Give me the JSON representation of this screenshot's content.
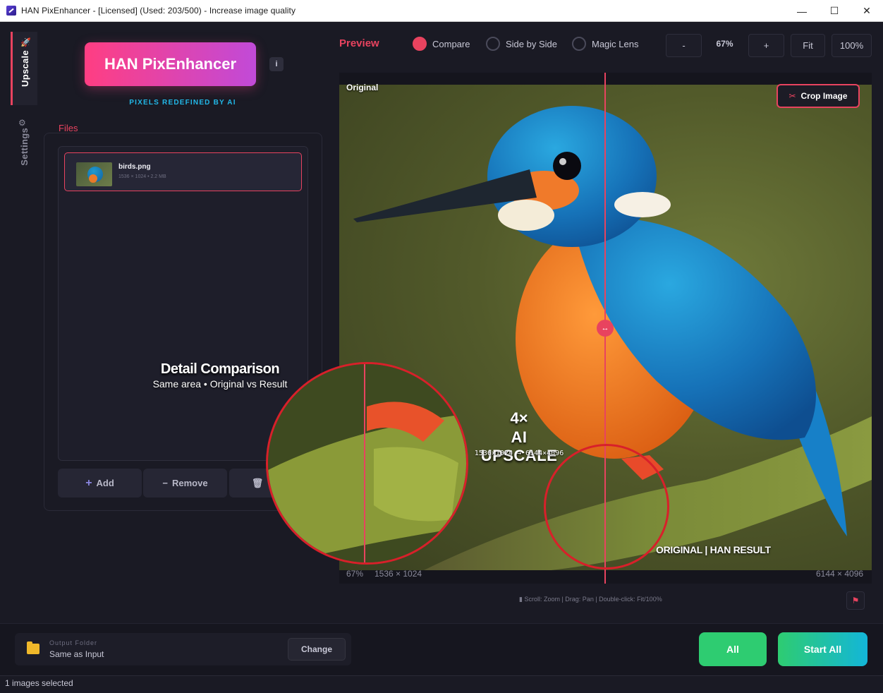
{
  "window": {
    "title": "HAN PixEnhancer - [Licensed] (Used: 203/500) - Increase image quality",
    "controls": {
      "minimize": "—",
      "maximize": "☐",
      "close": "✕"
    }
  },
  "sidebar": {
    "tabs": [
      {
        "label": "Upscale",
        "icon": "rocket-icon",
        "active": true
      },
      {
        "label": "Settings",
        "icon": "gear-icon",
        "active": false
      }
    ]
  },
  "brand": {
    "name": "HAN PixEnhancer",
    "tagline": "PIXELS REDEFINED BY AI",
    "info_icon": "i"
  },
  "files": {
    "label": "Files",
    "items": [
      {
        "name": "birds.png",
        "meta": "1536 × 1024  •  2.2 MB"
      }
    ],
    "buttons": {
      "add": "Add",
      "remove": "Remove"
    }
  },
  "preview": {
    "title": "Preview",
    "modes": [
      {
        "label": "Compare",
        "selected": true
      },
      {
        "label": "Side by Side",
        "selected": false
      },
      {
        "label": "Magic Lens",
        "selected": false
      }
    ],
    "zoom": {
      "minus": "-",
      "level": "67%",
      "plus": "+",
      "fit": "Fit",
      "full": "100%"
    },
    "original_label": "Original",
    "crop_label": "Crop Image",
    "footer": {
      "zoom": "67%",
      "original_size": "1536 × 1024",
      "result_size": "6144 × 4096"
    },
    "hint": "Scroll: Zoom  |  Drag: Pan  |  Double-click: Fit/100%"
  },
  "overlay": {
    "detail_title": "Detail Comparison",
    "detail_sub": "Same area • Original vs Result",
    "scale": "4×",
    "upscale_title": "AI UPSCALE",
    "upscale_dims": "1536×1024 → 6144×4096",
    "compare_label": "ORIGINAL | HAN RESULT"
  },
  "output": {
    "label": "Output Folder",
    "value": "Same as Input",
    "change": "Change"
  },
  "actions": {
    "all": "All",
    "start_all": "Start All"
  },
  "status": {
    "text": "1 images selected"
  },
  "colors": {
    "accent": "#e8435f",
    "green": "#2ecc71",
    "cyan": "#13b6d8",
    "background": "#1a1a24"
  }
}
